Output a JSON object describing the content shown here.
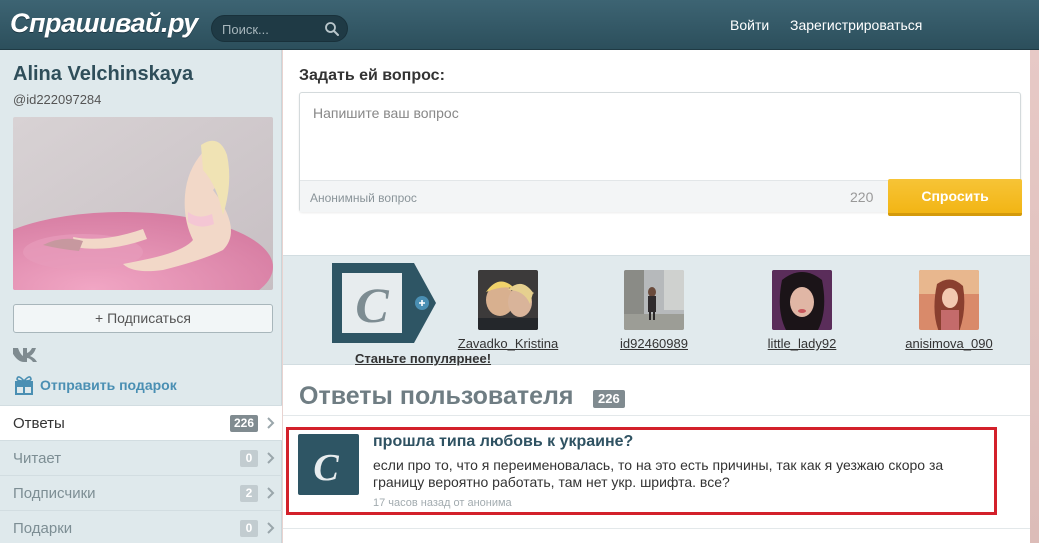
{
  "header": {
    "logo": "Спрашивай.ру",
    "search_placeholder": "Поиск...",
    "login": "Войти",
    "register": "Зарегистрироваться"
  },
  "profile": {
    "name": "Alina Velchinskaya",
    "username": "@id222097284",
    "subscribe_label": "+ Подписаться",
    "gift_label": "Отправить подарок"
  },
  "side_menu": [
    {
      "label": "Ответы",
      "count": "226"
    },
    {
      "label": "Читает",
      "count": "0"
    },
    {
      "label": "Подписчики",
      "count": "2"
    },
    {
      "label": "Подарки",
      "count": "0"
    }
  ],
  "ask": {
    "title": "Задать ей вопрос:",
    "placeholder": "Напишите ваш вопрос",
    "anonymous_label": "Анонимный вопрос",
    "char_count": "220",
    "submit_label": "Спросить"
  },
  "popular": {
    "promo_label": "Станьте популярнее!",
    "users": [
      {
        "name": "Zavadko_Kristina"
      },
      {
        "name": "id92460989"
      },
      {
        "name": "little_lady92"
      },
      {
        "name": "anisimova_090"
      }
    ]
  },
  "answers": {
    "title": "Ответы пользователя",
    "count": "226",
    "items": [
      {
        "question": "прошла типа любовь к украине?",
        "answer": "если про то, что я переименовалась, то на это есть причины, так как я уезжаю скоро за границу вероятно работать, там нет укр. шрифта. все?",
        "meta": "17 часов назад от анонима"
      }
    ]
  },
  "colors": {
    "header": "#2c4f5c",
    "accent_button": "#f2b515",
    "link": "#4a8fb3",
    "highlight": "#d3202a"
  }
}
